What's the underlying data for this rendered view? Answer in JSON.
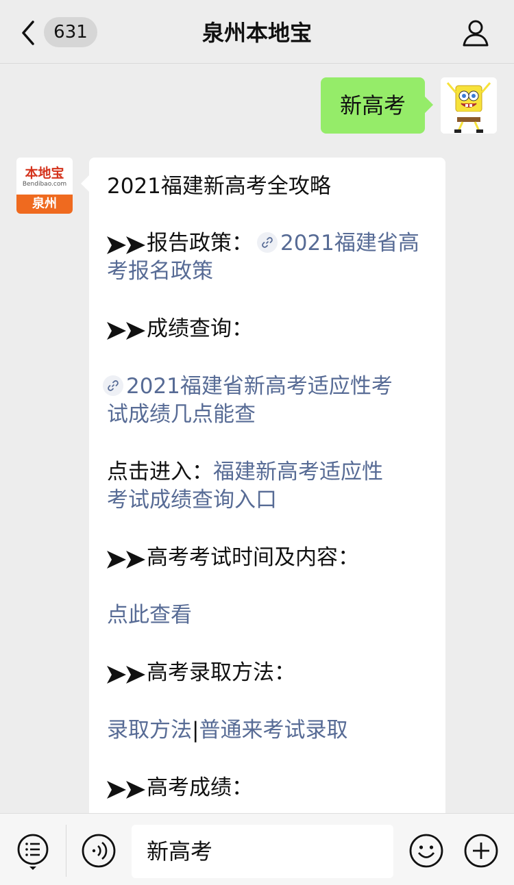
{
  "header": {
    "unread_count": "631",
    "title": "泉州本地宝"
  },
  "outgoing": {
    "text": "新高考"
  },
  "bot_avatar": {
    "logo_text": "本地宝",
    "logo_sub": "Bendibao.com",
    "city": "泉州"
  },
  "message": {
    "heading": "2021福建新高考全攻略",
    "s1_label": "报告政策：",
    "s1_link_line1": "2021福建省高",
    "s1_link_line2": "考报名政策",
    "s2_label": "成绩查询：",
    "s2_link_line1": "2021福建省新高考适应性考",
    "s2_link_line2": "试成绩几点能查",
    "s2_enter_label": "点击进入：",
    "s2_enter_link1": "福建新高考适应性",
    "s2_enter_link2": "考试成绩查询入口",
    "s3_label": "高考考试时间及内容：",
    "s3_link": "点此查看",
    "s4_label": "高考录取方法：",
    "s4_link_a": "录取方法",
    "s4_sep": "|",
    "s4_link_b": "普通来考试录取",
    "s5_label": "高考成绩："
  },
  "input": {
    "value": "新高考"
  },
  "colors": {
    "link": "#576b95",
    "outgoing_bubble": "#95ec69",
    "background": "#ededed"
  },
  "icons": [
    "back-arrow-icon",
    "person-icon",
    "link-icon",
    "double-arrow-icon",
    "menu-list-icon",
    "voice-icon",
    "emoji-icon",
    "plus-icon"
  ]
}
